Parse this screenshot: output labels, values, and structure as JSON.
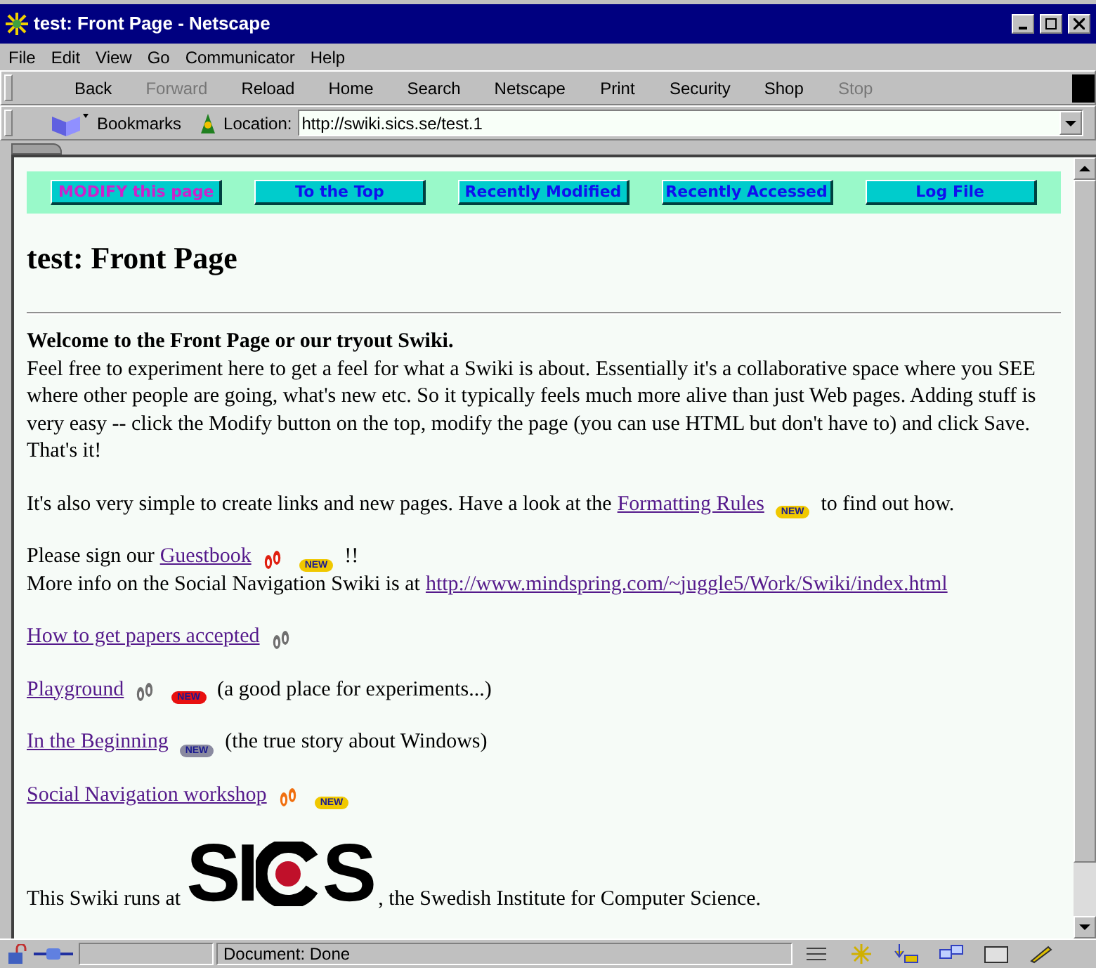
{
  "window": {
    "title": "test: Front Page - Netscape"
  },
  "menu": [
    "File",
    "Edit",
    "View",
    "Go",
    "Communicator",
    "Help"
  ],
  "toolbar": [
    {
      "label": "Back",
      "disabled": false
    },
    {
      "label": "Forward",
      "disabled": true
    },
    {
      "label": "Reload",
      "disabled": false
    },
    {
      "label": "Home",
      "disabled": false
    },
    {
      "label": "Search",
      "disabled": false
    },
    {
      "label": "Netscape",
      "disabled": false
    },
    {
      "label": "Print",
      "disabled": false
    },
    {
      "label": "Security",
      "disabled": false
    },
    {
      "label": "Shop",
      "disabled": false
    },
    {
      "label": "Stop",
      "disabled": true
    }
  ],
  "location_bar": {
    "bookmarks": "Bookmarks",
    "label": "Location:",
    "url": "http://swiki.sics.se/test.1"
  },
  "page": {
    "nav": [
      {
        "label": "MODIFY this page",
        "kind": "edit"
      },
      {
        "label": "To the Top",
        "kind": "link"
      },
      {
        "label": "Recently Modified",
        "kind": "link"
      },
      {
        "label": "Recently Accessed",
        "kind": "link"
      },
      {
        "label": "Log File",
        "kind": "link"
      }
    ],
    "heading": "test: Front Page",
    "intro": {
      "title": "Welcome to the Front Page or our tryout Swiki.",
      "text": "Feel free to experiment here to get a feel for what a Swiki is about. Essentially it's a collaborative space where you SEE where other people are going, what's new etc. So it typically feels much more alive than just Web pages. Adding stuff is very easy -- click the Modify button on the top, modify the page (you can use HTML but don't have to) and click Save. That's it!"
    },
    "blocks": [
      [
        [
          {
            "kind": "text",
            "text": "It's also very simple to create links and new pages. Have a look at the"
          },
          {
            "kind": "link",
            "text": "Formatting Rules"
          },
          {
            "kind": "badge",
            "text": "NEW",
            "color": "#f0c800"
          },
          {
            "kind": "text",
            "text": "to find out how."
          }
        ]
      ],
      [
        [
          {
            "kind": "text",
            "text": "Please sign our"
          },
          {
            "kind": "link",
            "text": "Guestbook"
          },
          {
            "kind": "footprints",
            "color": "#e02010"
          },
          {
            "kind": "badge",
            "text": "NEW",
            "color": "#f0c800"
          },
          {
            "kind": "text",
            "text": "!!"
          }
        ],
        [
          {
            "kind": "text",
            "text": "More info on the Social Navigation Swiki is at"
          },
          {
            "kind": "link",
            "text": "http://www.mindspring.com/~juggle5/Work/Swiki/index.html"
          }
        ]
      ],
      [
        [
          {
            "kind": "link",
            "text": "How to get papers accepted"
          },
          {
            "kind": "footprints",
            "color": "#707070"
          }
        ]
      ],
      [
        [
          {
            "kind": "link",
            "text": "Playground"
          },
          {
            "kind": "footprints",
            "color": "#707070"
          },
          {
            "kind": "badge",
            "text": "NEW",
            "color": "#e81010"
          },
          {
            "kind": "text",
            "text": "(a good place for experiments...)"
          }
        ]
      ],
      [
        [
          {
            "kind": "link",
            "text": "In the Beginning"
          },
          {
            "kind": "badge",
            "text": "NEW",
            "color": "#8a8aa0"
          },
          {
            "kind": "text",
            "text": "(the true story about Windows)"
          }
        ]
      ],
      [
        [
          {
            "kind": "link",
            "text": "Social Navigation workshop"
          },
          {
            "kind": "footprints",
            "color": "#f07010"
          },
          {
            "kind": "badge",
            "text": "NEW",
            "color": "#f0c800"
          }
        ]
      ],
      [
        [
          {
            "kind": "text",
            "text": "This Swiki runs at"
          },
          {
            "kind": "logo",
            "left": "SI",
            "right": "S"
          },
          {
            "kind": "text",
            "text": ", the Swedish Institute for Computer Science."
          }
        ]
      ]
    ]
  },
  "status_bar": {
    "text": "Document: Done"
  }
}
